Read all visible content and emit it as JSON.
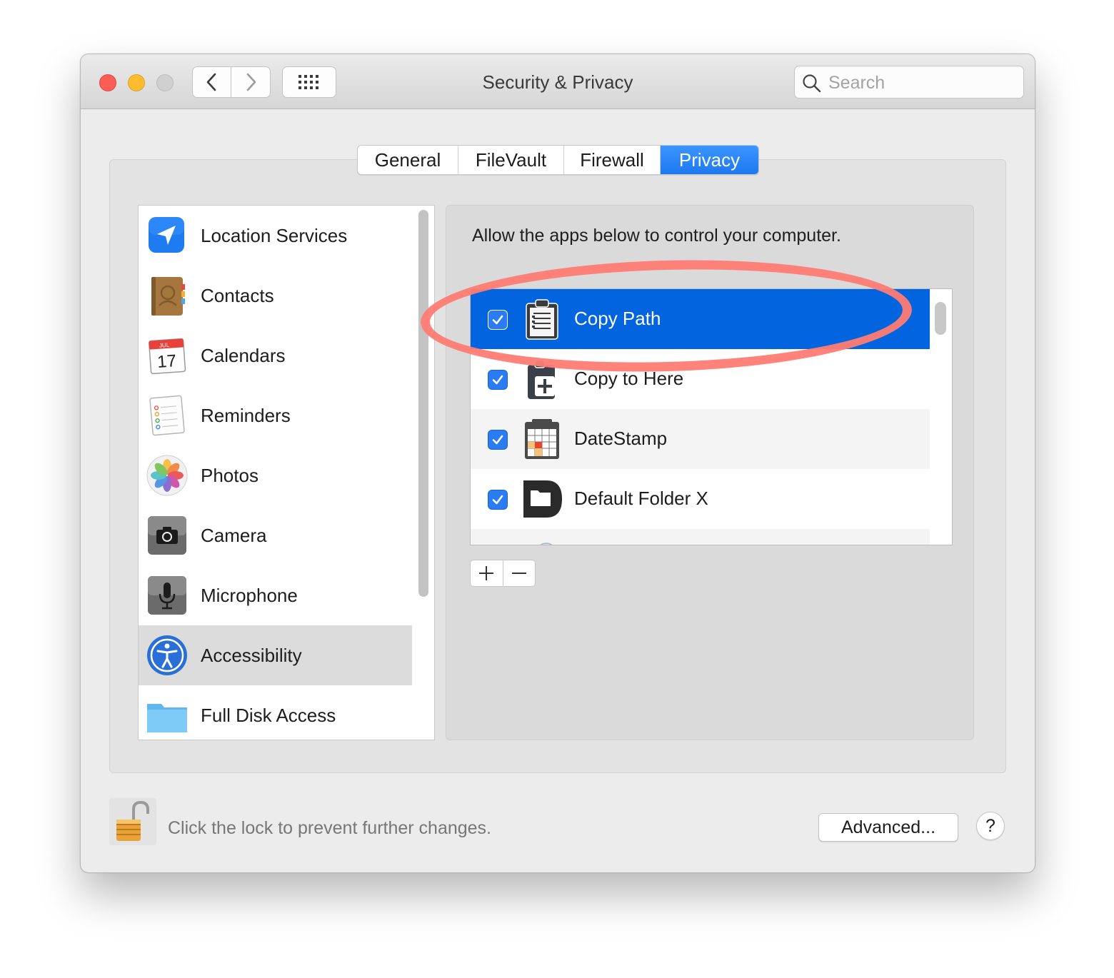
{
  "window": {
    "title": "Security & Privacy",
    "search_placeholder": "Search"
  },
  "tabs": [
    {
      "label": "General",
      "active": false
    },
    {
      "label": "FileVault",
      "active": false
    },
    {
      "label": "Firewall",
      "active": false
    },
    {
      "label": "Privacy",
      "active": true
    }
  ],
  "sidebar": {
    "items": [
      {
        "label": "Location Services",
        "icon": "location-arrow-icon"
      },
      {
        "label": "Contacts",
        "icon": "contacts-book-icon"
      },
      {
        "label": "Calendars",
        "icon": "calendar-icon",
        "icon_text": {
          "month": "JUL",
          "day": "17"
        }
      },
      {
        "label": "Reminders",
        "icon": "reminders-list-icon"
      },
      {
        "label": "Photos",
        "icon": "photos-flower-icon"
      },
      {
        "label": "Camera",
        "icon": "camera-icon"
      },
      {
        "label": "Microphone",
        "icon": "microphone-icon"
      },
      {
        "label": "Accessibility",
        "icon": "accessibility-figure-icon",
        "selected": true
      },
      {
        "label": "Full Disk Access",
        "icon": "folder-icon"
      }
    ]
  },
  "content": {
    "description": "Allow the apps below to control your computer.",
    "apps": [
      {
        "label": "Copy Path",
        "checked": true,
        "selected": true,
        "icon": "clipboard-list-icon"
      },
      {
        "label": "Copy to Here",
        "checked": true,
        "selected": false,
        "icon": "clipboard-plus-icon"
      },
      {
        "label": "DateStamp",
        "checked": true,
        "selected": false,
        "icon": "calendar-grid-icon"
      },
      {
        "label": "Default Folder X",
        "checked": true,
        "selected": false,
        "icon": "dark-folder-icon"
      }
    ],
    "add_symbol": "+",
    "remove_symbol": "−"
  },
  "footer": {
    "lock_text": "Click the lock to prevent further changes.",
    "advanced_label": "Advanced...",
    "help_label": "?"
  },
  "colors": {
    "accent": "#0364e0",
    "tab_active": "#1e78f2",
    "highlight_ring": "#ff7c74",
    "close": "#fd5f57",
    "minimize": "#febc2e"
  }
}
